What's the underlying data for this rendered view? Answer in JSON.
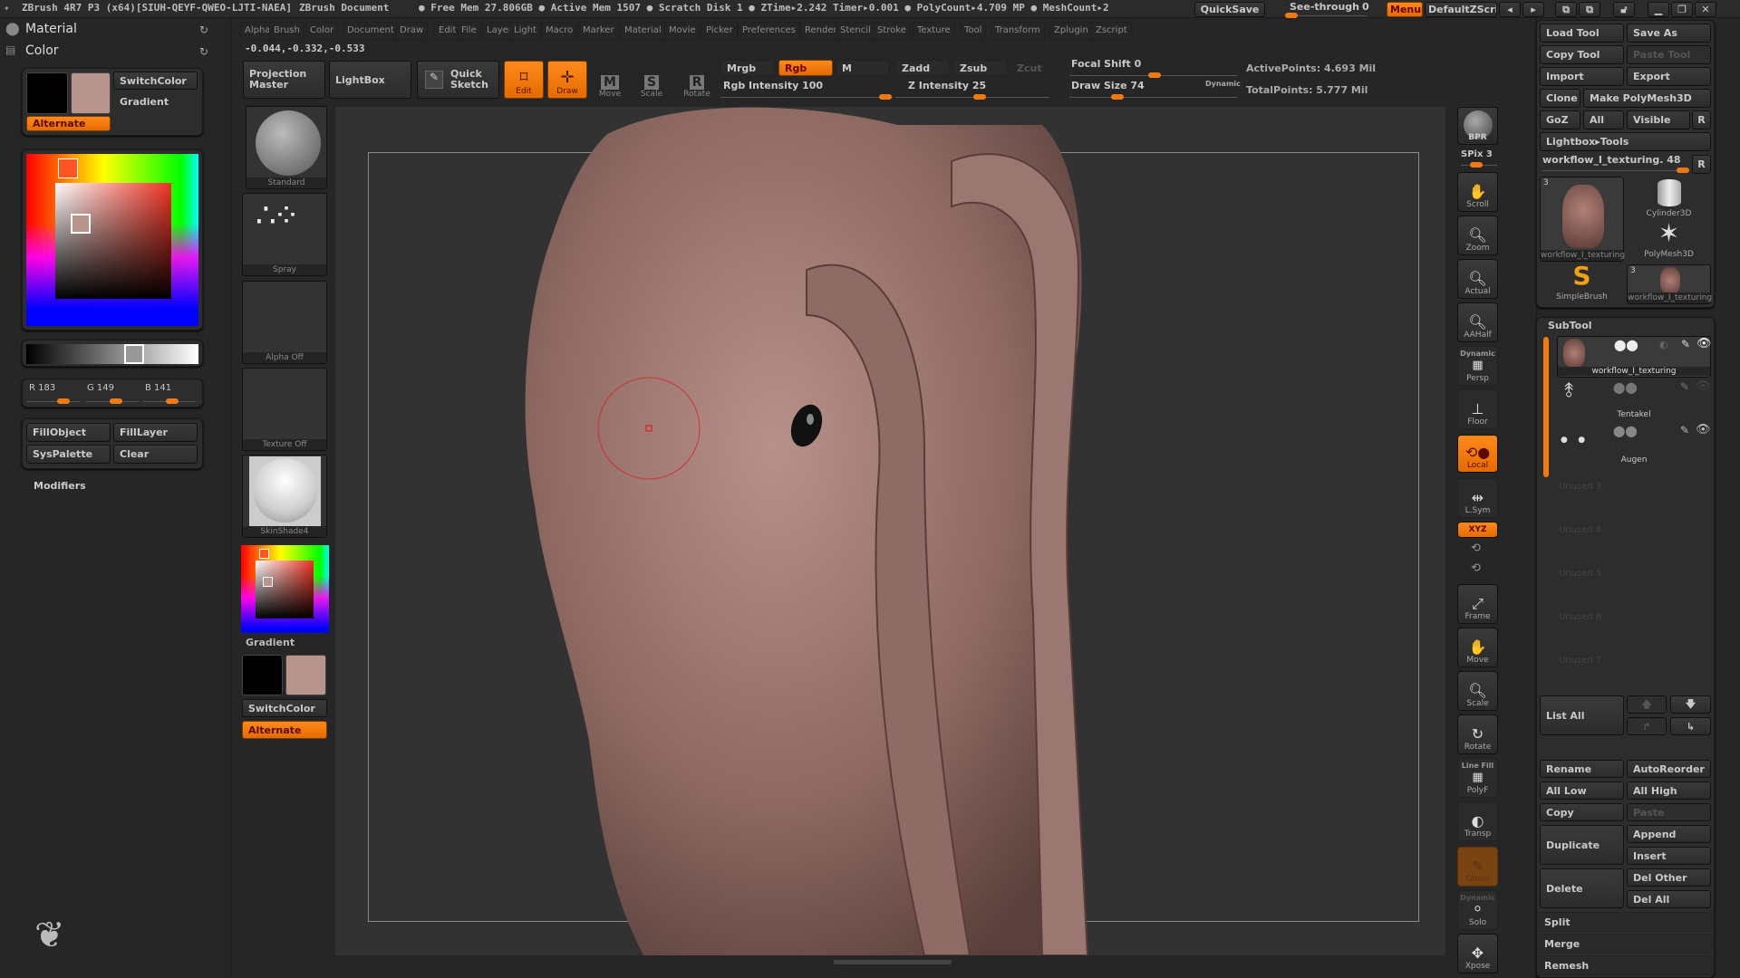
{
  "titlebar": {
    "app": "ZBrush 4R7 P3 (x64)[SIUH-QEYF-QWEO-LJTI-NAEA]",
    "document": "ZBrush Document",
    "stats": "● Free Mem 27.806GB ● Active Mem 1507 ● Scratch Disk 1 ●  ZTime▸2.242  Timer▸0.001 ● PolyCount▸4.709 MP  ● MeshCount▸2",
    "quicksave": "QuickSave",
    "see_through_label": "See-through",
    "see_through_value": "0",
    "see_through_level": 0,
    "menus": "Menus",
    "default_zscript": "DefaultZScript"
  },
  "menubar": [
    "Alpha",
    "Brush",
    "Color",
    "Document",
    "Draw",
    "Edit",
    "File",
    "Layer",
    "Light",
    "Macro",
    "Marker",
    "Material",
    "Movie",
    "Picker",
    "Preferences",
    "Render",
    "Stencil",
    "Stroke",
    "Texture",
    "Tool",
    "Transform",
    "Zplugin",
    "Zscript"
  ],
  "coords": "-0.044,-0.332,-0.533",
  "toolbar": {
    "projection_master": "Projection Master",
    "lightbox": "LightBox",
    "quick_sketch": "Quick Sketch",
    "edit": "Edit",
    "draw": "Draw",
    "move": "Move",
    "scale": "Scale",
    "rotate": "Rotate",
    "mrgb": "Mrgb",
    "rgb": "Rgb",
    "m": "M",
    "zadd": "Zadd",
    "zsub": "Zsub",
    "zcut": "Zcut",
    "rgb_intensity": "Rgb Intensity 100",
    "z_intensity": "Z Intensity 25",
    "focal_shift": "Focal Shift 0",
    "draw_size": "Draw Size 74",
    "dynamic": "Dynamic",
    "active_points": "ActivePoints: 4.693 Mil",
    "total_points": "TotalPoints: 5.777 Mil",
    "rgb_intensity_value": 100,
    "z_intensity_value": 25,
    "focal_shift_value": 0,
    "draw_size_value": 74
  },
  "left_panel": {
    "material": "Material",
    "color": "Color",
    "switch_color": "SwitchColor",
    "gradient": "Gradient",
    "alternate": "Alternate",
    "main_color": "#b7958d",
    "secondary_color": "#000000",
    "r_label": "R 183",
    "g_label": "G 149",
    "b_label": "B 141",
    "fill_object": "FillObject",
    "fill_layer": "FillLayer",
    "sys_palette": "SysPalette",
    "clear": "Clear",
    "modifiers": "Modifiers"
  },
  "left_shelf": {
    "brush": "Standard",
    "stroke": "Spray",
    "alpha": "Alpha Off",
    "texture": "Texture Off",
    "material": "SkinShade4",
    "gradient": "Gradient",
    "switch_color": "SwitchColor",
    "alternate": "Alternate"
  },
  "right_shelf": {
    "bpr": "BPR",
    "spix": "SPix 3",
    "scroll": "Scroll",
    "zoom": "Zoom",
    "actual": "Actual",
    "aahalf": "AAHalf",
    "persp_dynamic": "Dynamic",
    "persp": "Persp",
    "floor": "Floor",
    "local": "Local",
    "lsym": "L.Sym",
    "xyz": "XYZ",
    "frame": "Frame",
    "move": "Move",
    "scale": "Scale",
    "rotate": "Rotate",
    "line_fill": "Line Fill",
    "polyf": "PolyF",
    "transp": "Transp",
    "ghost": "Ghost",
    "solo_dynamic": "Dynamic",
    "solo": "Solo",
    "xpose": "Xpose"
  },
  "tool_panel": {
    "load_tool": "Load Tool",
    "save_as": "Save As",
    "copy_tool": "Copy Tool",
    "paste_tool": "Paste Tool",
    "import": "Import",
    "export": "Export",
    "clone": "Clone",
    "make_polymesh": "Make PolyMesh3D",
    "goz": "GoZ",
    "all": "All",
    "visible": "Visible",
    "r": "R",
    "lightbox_tools": "Lightbox▸Tools",
    "current_tool": "workflow_I_texturing. 48",
    "tools": [
      {
        "name": "workflow_I_texturing",
        "badge": "3"
      },
      {
        "name": "Cylinder3D",
        "badge": ""
      },
      {
        "name": "PolyMesh3D",
        "badge": ""
      },
      {
        "name": "SimpleBrush",
        "badge": ""
      },
      {
        "name": "workflow_I_texturing",
        "badge": "3"
      }
    ]
  },
  "subtool": {
    "title": "SubTool",
    "items": [
      {
        "name": "workflow_I_texturing",
        "active": true
      },
      {
        "name": "Tentakel",
        "active": false
      },
      {
        "name": "Augen",
        "active": false
      }
    ],
    "unused": [
      "Unused 3",
      "Unused 4",
      "Unused 5",
      "Unused 6",
      "Unused 7"
    ],
    "list_all": "List All",
    "rename": "Rename",
    "auto_reorder": "AutoReorder",
    "all_low": "All Low",
    "all_high": "All High",
    "copy": "Copy",
    "paste": "Paste",
    "duplicate": "Duplicate",
    "append": "Append",
    "insert": "Insert",
    "delete": "Delete",
    "del_other": "Del Other",
    "del_all": "Del All",
    "split": "Split",
    "merge": "Merge",
    "remesh": "Remesh"
  },
  "colors": {
    "accent": "#f07a10",
    "background": "#262626",
    "viewport": "#323232",
    "model": "#a07a72"
  }
}
